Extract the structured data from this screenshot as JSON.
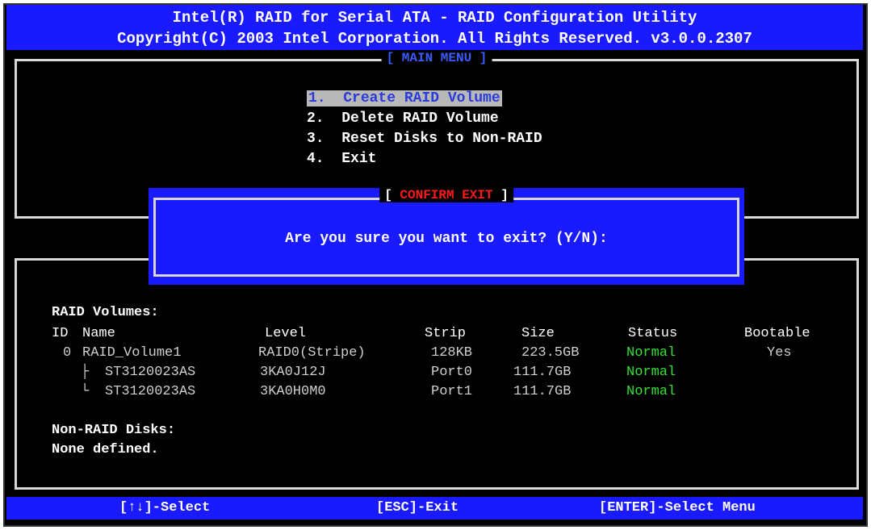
{
  "header": {
    "line1": "Intel(R) RAID for Serial ATA - RAID Configuration Utility",
    "line2": "Copyright(C) 2003 Intel Corporation.  All Rights Reserved. v3.0.0.2307"
  },
  "main_menu": {
    "title": "[ MAIN MENU ]",
    "items": [
      {
        "num": "1.",
        "label": "Create RAID Volume"
      },
      {
        "num": "2.",
        "label": "Delete RAID Volume"
      },
      {
        "num": "3.",
        "label": "Reset Disks to Non-RAID"
      },
      {
        "num": "4.",
        "label": "Exit"
      }
    ]
  },
  "dialog": {
    "title_open": "[ ",
    "title": "CONFIRM EXIT",
    "title_close": " ]",
    "message": "Are you sure you want to exit? (Y/N):"
  },
  "raid_volumes": {
    "label": "RAID Volumes:",
    "headers": {
      "id": "ID",
      "name": "Name",
      "level": "Level",
      "strip": "Strip",
      "size": "Size",
      "status": "Status",
      "bootable": "Bootable"
    },
    "volume": {
      "id": "0",
      "name": "RAID_Volume1",
      "level": "RAID0(Stripe)",
      "strip": "128KB",
      "size": "223.5GB",
      "status": "Normal",
      "bootable": "Yes"
    },
    "disks": [
      {
        "tree": "├",
        "name": "ST3120023AS",
        "level": "3KA0J12J",
        "strip": "Port0",
        "size": "111.7GB",
        "status": "Normal"
      },
      {
        "tree": "└",
        "name": "ST3120023AS",
        "level": "3KA0H0M0",
        "strip": "Port1",
        "size": "111.7GB",
        "status": "Normal"
      }
    ]
  },
  "non_raid": {
    "label": "Non-RAID Disks:",
    "value": "None defined."
  },
  "footer": {
    "select": "[↑↓]-Select",
    "exit": "[ESC]-Exit",
    "enter": "[ENTER]-Select Menu"
  }
}
